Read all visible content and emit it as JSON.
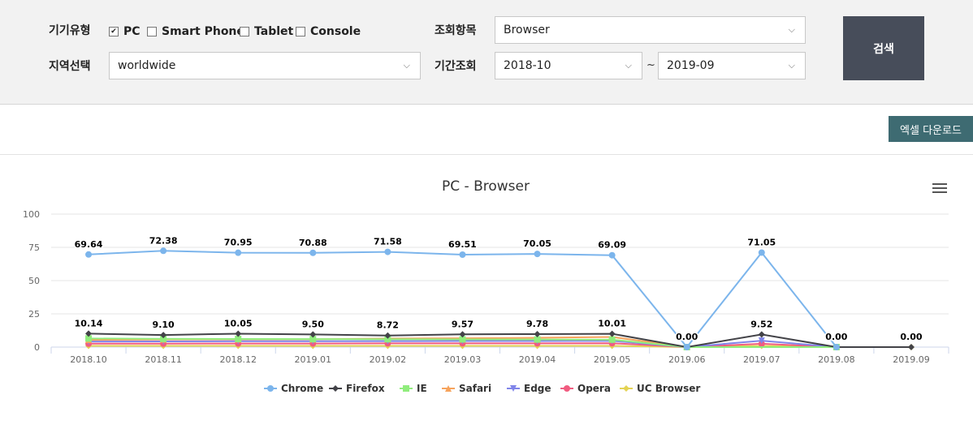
{
  "filters": {
    "device_label": "기기유형",
    "devices": [
      {
        "label": "PC",
        "checked": true
      },
      {
        "label": "Smart Phone",
        "checked": false
      },
      {
        "label": "Tablet",
        "checked": false
      },
      {
        "label": "Console",
        "checked": false
      }
    ],
    "region_label": "지역선택",
    "region_value": "worldwide",
    "item_label": "조회항목",
    "item_value": "Browser",
    "period_label": "기간조회",
    "period_from": "2018-10",
    "period_tilde": "~",
    "period_to": "2019-09",
    "search_label": "검색"
  },
  "toolbar": {
    "excel_label": "엑셀 다운로드"
  },
  "chart_data": {
    "type": "line",
    "title": "PC - Browser",
    "xlabel": "",
    "ylabel": "",
    "ylim": [
      0,
      100
    ],
    "yticks": [
      0,
      25,
      50,
      75,
      100
    ],
    "grid": true,
    "legend_position": "bottom-center",
    "categories": [
      "2018.10",
      "2018.11",
      "2018.12",
      "2019.01",
      "2019.02",
      "2019.03",
      "2019.04",
      "2019.05",
      "2019.06",
      "2019.07",
      "2019.08",
      "2019.09"
    ],
    "series": [
      {
        "name": "Chrome",
        "color": "#7cb5ec",
        "marker": "circle",
        "values": [
          69.64,
          72.38,
          70.95,
          70.88,
          71.58,
          69.51,
          70.05,
          69.09,
          0,
          71.05,
          0,
          null
        ],
        "labels": true
      },
      {
        "name": "Firefox",
        "color": "#434348",
        "marker": "diamond",
        "values": [
          10.14,
          9.1,
          10.05,
          9.5,
          8.72,
          9.57,
          9.78,
          10.01,
          0,
          9.52,
          0,
          0
        ],
        "labels": true
      },
      {
        "name": "IE",
        "color": "#90ed7d",
        "marker": "square",
        "values": [
          6.5,
          6.2,
          6.1,
          6.0,
          5.9,
          5.8,
          5.7,
          5.6,
          0,
          null,
          0,
          null
        ],
        "labels": false
      },
      {
        "name": "Safari",
        "color": "#f7a35c",
        "marker": "triangle",
        "values": [
          5.4,
          5.7,
          5.8,
          5.9,
          6.4,
          6.6,
          7.0,
          7.6,
          0,
          null,
          0,
          null
        ],
        "labels": false
      },
      {
        "name": "Edge",
        "color": "#8085e9",
        "marker": "triangle-down",
        "values": [
          4.2,
          4.3,
          4.4,
          4.4,
          4.5,
          4.6,
          4.6,
          4.7,
          0,
          4.8,
          0,
          null
        ],
        "labels": false
      },
      {
        "name": "Opera",
        "color": "#f15c80",
        "marker": "circle",
        "values": [
          2.6,
          2.6,
          2.7,
          2.7,
          2.8,
          2.8,
          2.8,
          2.9,
          0,
          2.5,
          0,
          null
        ],
        "labels": false
      },
      {
        "name": "UC Browser",
        "color": "#e4d354",
        "marker": "diamond",
        "values": [
          0.9,
          0.9,
          0.9,
          0.9,
          0.9,
          0.9,
          0.9,
          0.9,
          0,
          0.9,
          0,
          0
        ],
        "labels": false
      }
    ]
  }
}
